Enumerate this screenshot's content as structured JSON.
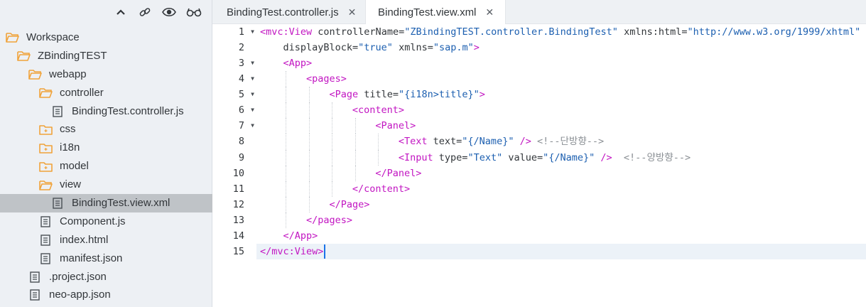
{
  "sidebar": {
    "toolbar": {
      "icons": [
        "collapse-icon",
        "link-icon",
        "eye-icon",
        "glasses-icon"
      ]
    },
    "tree": [
      {
        "label": "Workspace",
        "icon": "folder-open",
        "level": 0
      },
      {
        "label": "ZBindingTEST",
        "icon": "folder-open",
        "level": 1
      },
      {
        "label": "webapp",
        "icon": "folder-open",
        "level": 2
      },
      {
        "label": "controller",
        "icon": "folder-open",
        "level": 3
      },
      {
        "label": "BindingTest.controller.js",
        "icon": "file",
        "level": 4
      },
      {
        "label": "css",
        "icon": "folder-closed",
        "level": 3
      },
      {
        "label": "i18n",
        "icon": "folder-closed",
        "level": 3
      },
      {
        "label": "model",
        "icon": "folder-closed",
        "level": 3
      },
      {
        "label": "view",
        "icon": "folder-open",
        "level": 3
      },
      {
        "label": "BindingTest.view.xml",
        "icon": "file",
        "level": 4,
        "selected": true
      },
      {
        "label": "Component.js",
        "icon": "file",
        "level": 3
      },
      {
        "label": "index.html",
        "icon": "file",
        "level": 3
      },
      {
        "label": "manifest.json",
        "icon": "file",
        "level": 3
      },
      {
        "label": ".project.json",
        "icon": "file",
        "level": 2
      },
      {
        "label": "neo-app.json",
        "icon": "file",
        "level": 2
      }
    ]
  },
  "tabs": [
    {
      "label": "BindingTest.controller.js",
      "close": "✕",
      "active": false
    },
    {
      "label": "BindingTest.view.xml",
      "close": "✕",
      "active": true
    }
  ],
  "editor": {
    "current_line": 15,
    "lines": [
      {
        "n": "1",
        "fold": true,
        "indent": 0,
        "segs": [
          [
            "tag",
            "<mvc:View"
          ],
          [
            "attr",
            " controllerName="
          ],
          [
            "str",
            "\"ZBindingTEST.controller.BindingTest\""
          ],
          [
            "attr",
            " xmlns:html="
          ],
          [
            "str",
            "\"http://www.w3.org/1999/xhtml\""
          ]
        ]
      },
      {
        "n": "2",
        "fold": false,
        "indent": 0,
        "segs": [
          [
            "attr",
            "    displayBlock="
          ],
          [
            "str",
            "\"true\""
          ],
          [
            "attr",
            " xmlns="
          ],
          [
            "str",
            "\"sap.m\""
          ],
          [
            "tag",
            ">"
          ]
        ]
      },
      {
        "n": "3",
        "fold": true,
        "indent": 1,
        "segs": [
          [
            "tag",
            "<App>"
          ]
        ]
      },
      {
        "n": "4",
        "fold": true,
        "indent": 2,
        "segs": [
          [
            "tag",
            "<pages>"
          ]
        ]
      },
      {
        "n": "5",
        "fold": true,
        "indent": 3,
        "segs": [
          [
            "tag",
            "<Page"
          ],
          [
            "attr",
            " title="
          ],
          [
            "str",
            "\"{i18n>title}\""
          ],
          [
            "tag",
            ">"
          ]
        ]
      },
      {
        "n": "6",
        "fold": true,
        "indent": 4,
        "segs": [
          [
            "tag",
            "<content>"
          ]
        ]
      },
      {
        "n": "7",
        "fold": true,
        "indent": 5,
        "segs": [
          [
            "tag",
            "<Panel>"
          ]
        ]
      },
      {
        "n": "8",
        "fold": false,
        "indent": 6,
        "segs": [
          [
            "tag",
            "<Text"
          ],
          [
            "attr",
            " text="
          ],
          [
            "str",
            "\"{/Name}\""
          ],
          [
            "tag",
            " />"
          ],
          [
            "cmt",
            " <!--단방향-->"
          ]
        ]
      },
      {
        "n": "9",
        "fold": false,
        "indent": 6,
        "segs": [
          [
            "tag",
            "<Input"
          ],
          [
            "attr",
            " type="
          ],
          [
            "str",
            "\"Text\""
          ],
          [
            "attr",
            " value="
          ],
          [
            "str",
            "\"{/Name}\""
          ],
          [
            "tag",
            " />"
          ],
          [
            "cmt",
            "  <!--양방향-->"
          ]
        ]
      },
      {
        "n": "10",
        "fold": false,
        "indent": 5,
        "segs": [
          [
            "tag",
            "</Panel>"
          ]
        ]
      },
      {
        "n": "11",
        "fold": false,
        "indent": 4,
        "segs": [
          [
            "tag",
            "</content>"
          ]
        ]
      },
      {
        "n": "12",
        "fold": false,
        "indent": 3,
        "segs": [
          [
            "tag",
            "</Page>"
          ]
        ]
      },
      {
        "n": "13",
        "fold": false,
        "indent": 2,
        "segs": [
          [
            "tag",
            "</pages>"
          ]
        ]
      },
      {
        "n": "14",
        "fold": false,
        "indent": 1,
        "segs": [
          [
            "tag",
            "</App>"
          ]
        ]
      },
      {
        "n": "15",
        "fold": false,
        "indent": 0,
        "segs": [
          [
            "tag",
            "</mvc:View>"
          ]
        ]
      }
    ]
  },
  "colors": {
    "tag": "#c216c2",
    "string": "#1c5fb0",
    "comment": "#8a8f94",
    "folder": "#f0a33a",
    "cursor": "#1a73e8"
  }
}
